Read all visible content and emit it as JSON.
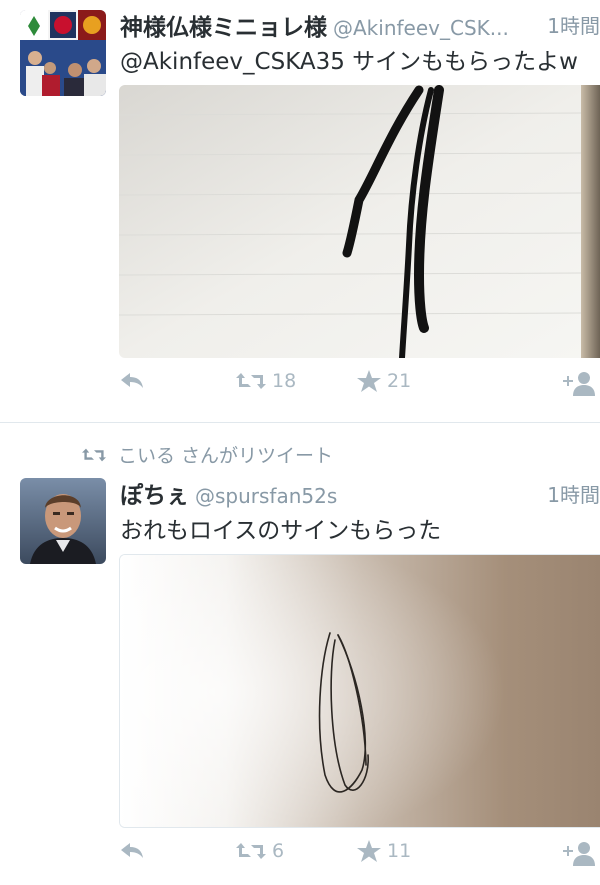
{
  "tweets": [
    {
      "name": "神様仏様ミニョレ様",
      "handle": "@Akinfeev_CSK...",
      "time": "1時間",
      "text": "@Akinfeev_CSKA35 サインももらったよw",
      "retweets": "18",
      "favorites": "21"
    },
    {
      "retweet_banner": "こいる さんがリツイート",
      "name": "ぽちぇ",
      "handle": "@spursfan52s",
      "time": "1時間",
      "text": "おれもロイスのサインもらった",
      "retweets": "6",
      "favorites": "11"
    }
  ],
  "icons": {
    "reply": "reply-arrow-icon",
    "retweet": "retweet-arrows-icon",
    "favorite": "star-icon",
    "follow": "add-user-icon"
  },
  "colors": {
    "icon_gray": "#aab8c2",
    "meta_gray": "#8899a6",
    "text": "#292f33",
    "divider": "#e1e8ed"
  }
}
